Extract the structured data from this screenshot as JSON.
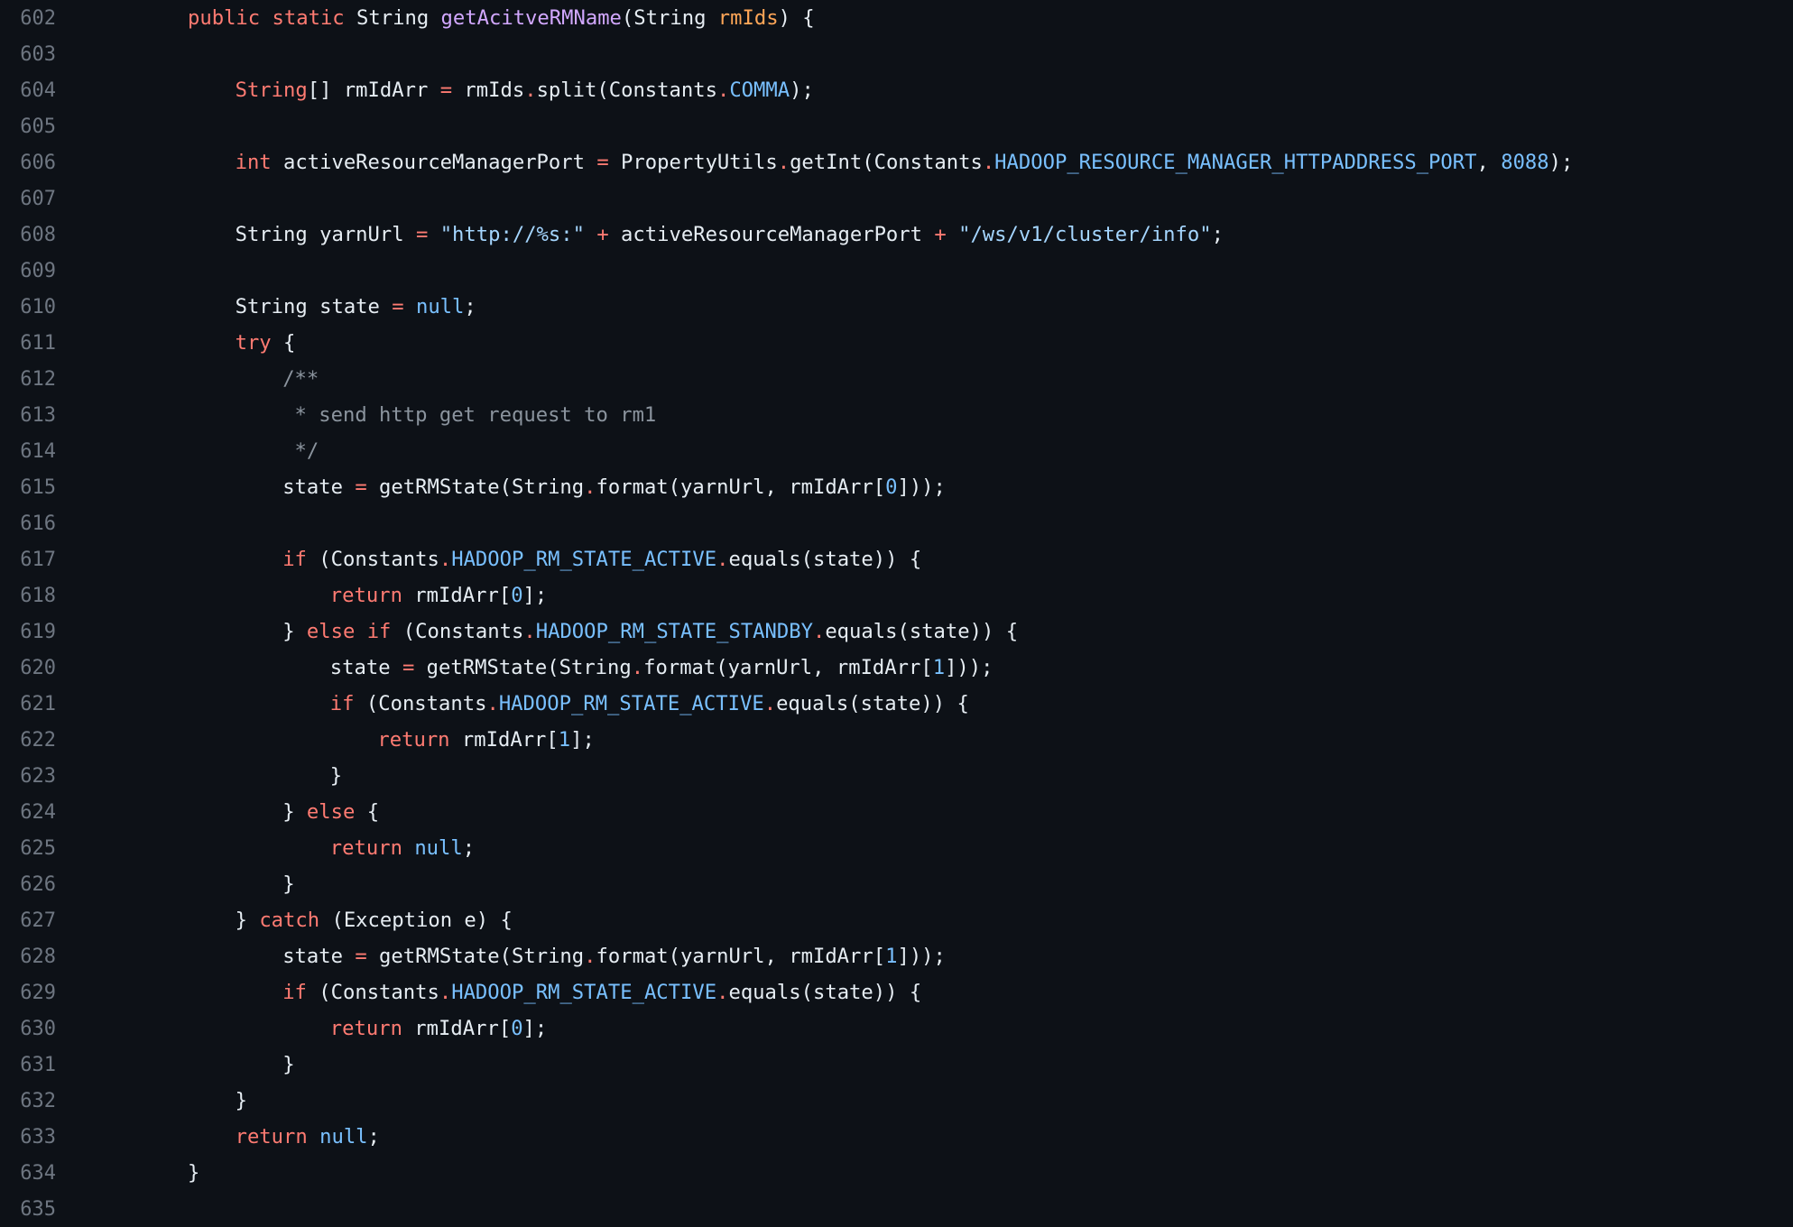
{
  "colors": {
    "background": "#0d1117",
    "line_number": "#6e7681",
    "text": "#e6edf3",
    "keyword": "#ff7b72",
    "function": "#d2a8ff",
    "parameter": "#ffa657",
    "constant": "#79c0ff",
    "string": "#a5d6ff",
    "comment": "#8b949e"
  },
  "code": {
    "lines": [
      {
        "number": "602",
        "indent": 0,
        "tokens": [
          [
            "kw",
            "public"
          ],
          [
            "plain",
            " "
          ],
          [
            "kw",
            "static"
          ],
          [
            "plain",
            " String "
          ],
          [
            "fn",
            "getAcitveRMName"
          ],
          [
            "plain",
            "(String "
          ],
          [
            "param",
            "rmIds"
          ],
          [
            "plain",
            ") {"
          ]
        ]
      },
      {
        "number": "603",
        "indent": 0,
        "tokens": []
      },
      {
        "number": "604",
        "indent": 1,
        "tokens": [
          [
            "kw",
            "String"
          ],
          [
            "plain",
            "[] rmIdArr "
          ],
          [
            "kw",
            "="
          ],
          [
            "plain",
            " rmIds"
          ],
          [
            "kw",
            "."
          ],
          [
            "plain",
            "split(Constants"
          ],
          [
            "kw",
            "."
          ],
          [
            "const",
            "COMMA"
          ],
          [
            "plain",
            ");"
          ]
        ]
      },
      {
        "number": "605",
        "indent": 0,
        "tokens": []
      },
      {
        "number": "606",
        "indent": 1,
        "tokens": [
          [
            "kw",
            "int"
          ],
          [
            "plain",
            " activeResourceManagerPort "
          ],
          [
            "kw",
            "="
          ],
          [
            "plain",
            " PropertyUtils"
          ],
          [
            "kw",
            "."
          ],
          [
            "plain",
            "getInt(Constants"
          ],
          [
            "kw",
            "."
          ],
          [
            "const",
            "HADOOP_RESOURCE_MANAGER_HTTPADDRESS_PORT"
          ],
          [
            "plain",
            ", "
          ],
          [
            "const",
            "8088"
          ],
          [
            "plain",
            ");"
          ]
        ]
      },
      {
        "number": "607",
        "indent": 0,
        "tokens": []
      },
      {
        "number": "608",
        "indent": 1,
        "tokens": [
          [
            "plain",
            "String yarnUrl "
          ],
          [
            "kw",
            "="
          ],
          [
            "plain",
            " "
          ],
          [
            "str",
            "\"http://%s:\""
          ],
          [
            "plain",
            " "
          ],
          [
            "kw",
            "+"
          ],
          [
            "plain",
            " activeResourceManagerPort "
          ],
          [
            "kw",
            "+"
          ],
          [
            "plain",
            " "
          ],
          [
            "str",
            "\"/ws/v1/cluster/info\""
          ],
          [
            "plain",
            ";"
          ]
        ]
      },
      {
        "number": "609",
        "indent": 0,
        "tokens": []
      },
      {
        "number": "610",
        "indent": 1,
        "tokens": [
          [
            "plain",
            "String state "
          ],
          [
            "kw",
            "="
          ],
          [
            "plain",
            " "
          ],
          [
            "const",
            "null"
          ],
          [
            "plain",
            ";"
          ]
        ]
      },
      {
        "number": "611",
        "indent": 1,
        "tokens": [
          [
            "kw",
            "try"
          ],
          [
            "plain",
            " {"
          ]
        ]
      },
      {
        "number": "612",
        "indent": 2,
        "tokens": [
          [
            "comment",
            "/**"
          ]
        ]
      },
      {
        "number": "613",
        "indent": 2,
        "tokens": [
          [
            "comment",
            " * send http get request to rm1"
          ]
        ]
      },
      {
        "number": "614",
        "indent": 2,
        "tokens": [
          [
            "comment",
            " */"
          ]
        ]
      },
      {
        "number": "615",
        "indent": 2,
        "tokens": [
          [
            "plain",
            "state "
          ],
          [
            "kw",
            "="
          ],
          [
            "plain",
            " getRMState(String"
          ],
          [
            "kw",
            "."
          ],
          [
            "plain",
            "format(yarnUrl, rmIdArr["
          ],
          [
            "const",
            "0"
          ],
          [
            "plain",
            "]));"
          ]
        ]
      },
      {
        "number": "616",
        "indent": 0,
        "tokens": []
      },
      {
        "number": "617",
        "indent": 2,
        "tokens": [
          [
            "kw",
            "if"
          ],
          [
            "plain",
            " (Constants"
          ],
          [
            "kw",
            "."
          ],
          [
            "const",
            "HADOOP_RM_STATE_ACTIVE"
          ],
          [
            "kw",
            "."
          ],
          [
            "plain",
            "equals(state)) {"
          ]
        ]
      },
      {
        "number": "618",
        "indent": 3,
        "tokens": [
          [
            "kw",
            "return"
          ],
          [
            "plain",
            " rmIdArr["
          ],
          [
            "const",
            "0"
          ],
          [
            "plain",
            "];"
          ]
        ]
      },
      {
        "number": "619",
        "indent": 2,
        "tokens": [
          [
            "plain",
            "} "
          ],
          [
            "kw",
            "else"
          ],
          [
            "plain",
            " "
          ],
          [
            "kw",
            "if"
          ],
          [
            "plain",
            " (Constants"
          ],
          [
            "kw",
            "."
          ],
          [
            "const",
            "HADOOP_RM_STATE_STANDBY"
          ],
          [
            "kw",
            "."
          ],
          [
            "plain",
            "equals(state)) {"
          ]
        ]
      },
      {
        "number": "620",
        "indent": 3,
        "tokens": [
          [
            "plain",
            "state "
          ],
          [
            "kw",
            "="
          ],
          [
            "plain",
            " getRMState(String"
          ],
          [
            "kw",
            "."
          ],
          [
            "plain",
            "format(yarnUrl, rmIdArr["
          ],
          [
            "const",
            "1"
          ],
          [
            "plain",
            "]));"
          ]
        ]
      },
      {
        "number": "621",
        "indent": 3,
        "tokens": [
          [
            "kw",
            "if"
          ],
          [
            "plain",
            " (Constants"
          ],
          [
            "kw",
            "."
          ],
          [
            "const",
            "HADOOP_RM_STATE_ACTIVE"
          ],
          [
            "kw",
            "."
          ],
          [
            "plain",
            "equals(state)) {"
          ]
        ]
      },
      {
        "number": "622",
        "indent": 4,
        "tokens": [
          [
            "kw",
            "return"
          ],
          [
            "plain",
            " rmIdArr["
          ],
          [
            "const",
            "1"
          ],
          [
            "plain",
            "];"
          ]
        ]
      },
      {
        "number": "623",
        "indent": 3,
        "tokens": [
          [
            "plain",
            "}"
          ]
        ]
      },
      {
        "number": "624",
        "indent": 2,
        "tokens": [
          [
            "plain",
            "} "
          ],
          [
            "kw",
            "else"
          ],
          [
            "plain",
            " {"
          ]
        ]
      },
      {
        "number": "625",
        "indent": 3,
        "tokens": [
          [
            "kw",
            "return"
          ],
          [
            "plain",
            " "
          ],
          [
            "const",
            "null"
          ],
          [
            "plain",
            ";"
          ]
        ]
      },
      {
        "number": "626",
        "indent": 2,
        "tokens": [
          [
            "plain",
            "}"
          ]
        ]
      },
      {
        "number": "627",
        "indent": 1,
        "tokens": [
          [
            "plain",
            "} "
          ],
          [
            "kw",
            "catch"
          ],
          [
            "plain",
            " (Exception e) {"
          ]
        ]
      },
      {
        "number": "628",
        "indent": 2,
        "tokens": [
          [
            "plain",
            "state "
          ],
          [
            "kw",
            "="
          ],
          [
            "plain",
            " getRMState(String"
          ],
          [
            "kw",
            "."
          ],
          [
            "plain",
            "format(yarnUrl, rmIdArr["
          ],
          [
            "const",
            "1"
          ],
          [
            "plain",
            "]));"
          ]
        ]
      },
      {
        "number": "629",
        "indent": 2,
        "tokens": [
          [
            "kw",
            "if"
          ],
          [
            "plain",
            " (Constants"
          ],
          [
            "kw",
            "."
          ],
          [
            "const",
            "HADOOP_RM_STATE_ACTIVE"
          ],
          [
            "kw",
            "."
          ],
          [
            "plain",
            "equals(state)) {"
          ]
        ]
      },
      {
        "number": "630",
        "indent": 3,
        "tokens": [
          [
            "kw",
            "return"
          ],
          [
            "plain",
            " rmIdArr["
          ],
          [
            "const",
            "0"
          ],
          [
            "plain",
            "];"
          ]
        ]
      },
      {
        "number": "631",
        "indent": 2,
        "tokens": [
          [
            "plain",
            "}"
          ]
        ]
      },
      {
        "number": "632",
        "indent": 1,
        "tokens": [
          [
            "plain",
            "}"
          ]
        ]
      },
      {
        "number": "633",
        "indent": 1,
        "tokens": [
          [
            "kw",
            "return"
          ],
          [
            "plain",
            " "
          ],
          [
            "const",
            "null"
          ],
          [
            "plain",
            ";"
          ]
        ]
      },
      {
        "number": "634",
        "indent": 0,
        "tokens": [
          [
            "plain",
            "}"
          ]
        ]
      },
      {
        "number": "635",
        "indent": 0,
        "tokens": []
      }
    ]
  }
}
